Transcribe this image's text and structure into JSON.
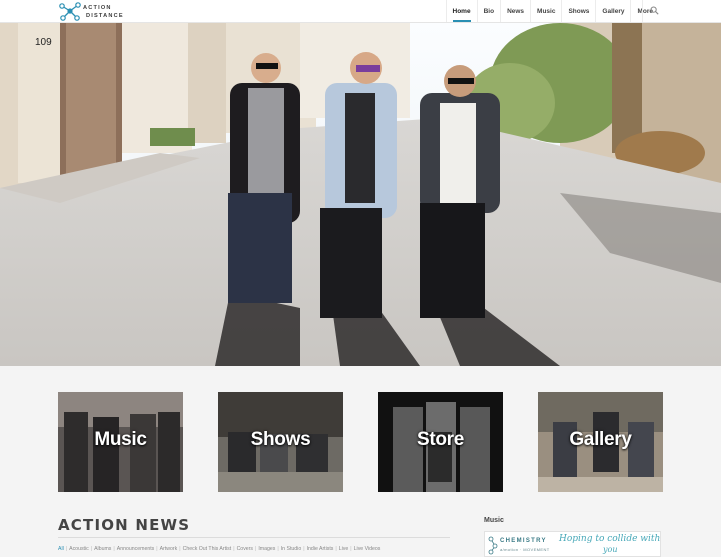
{
  "header": {
    "logo_line1": "ACTION",
    "logo_line2": "DISTANCE",
    "nav": [
      {
        "label": "Home",
        "active": true
      },
      {
        "label": "Bio"
      },
      {
        "label": "News"
      },
      {
        "label": "Music"
      },
      {
        "label": "Shows"
      },
      {
        "label": "Gallery"
      },
      {
        "label": "More"
      }
    ],
    "search_icon": "search-icon"
  },
  "hero": {
    "building_number": "109",
    "description_icon": "band-photo"
  },
  "tiles": [
    {
      "label": "Music"
    },
    {
      "label": "Shows"
    },
    {
      "label": "Store"
    },
    {
      "label": "Gallery"
    }
  ],
  "news": {
    "title": "ACTION NEWS",
    "categories": [
      "All",
      "Acoustic",
      "Albums",
      "Announcements",
      "Artwork",
      "Check Out This Artist",
      "Covers",
      "Images",
      "In Studio",
      "Indie Artists",
      "Live",
      "Live Videos"
    ]
  },
  "sidebar": {
    "widget_title": "Music",
    "ad": {
      "brand": "CHEMISTRY",
      "sub": "a/motion · MOVEMENT",
      "script1": "Hoping to collide with",
      "script2": "you"
    }
  },
  "colors": {
    "accent": "#2a8fb3",
    "page_bg": "#f4f4f4",
    "header_bg": "#ffffff"
  }
}
